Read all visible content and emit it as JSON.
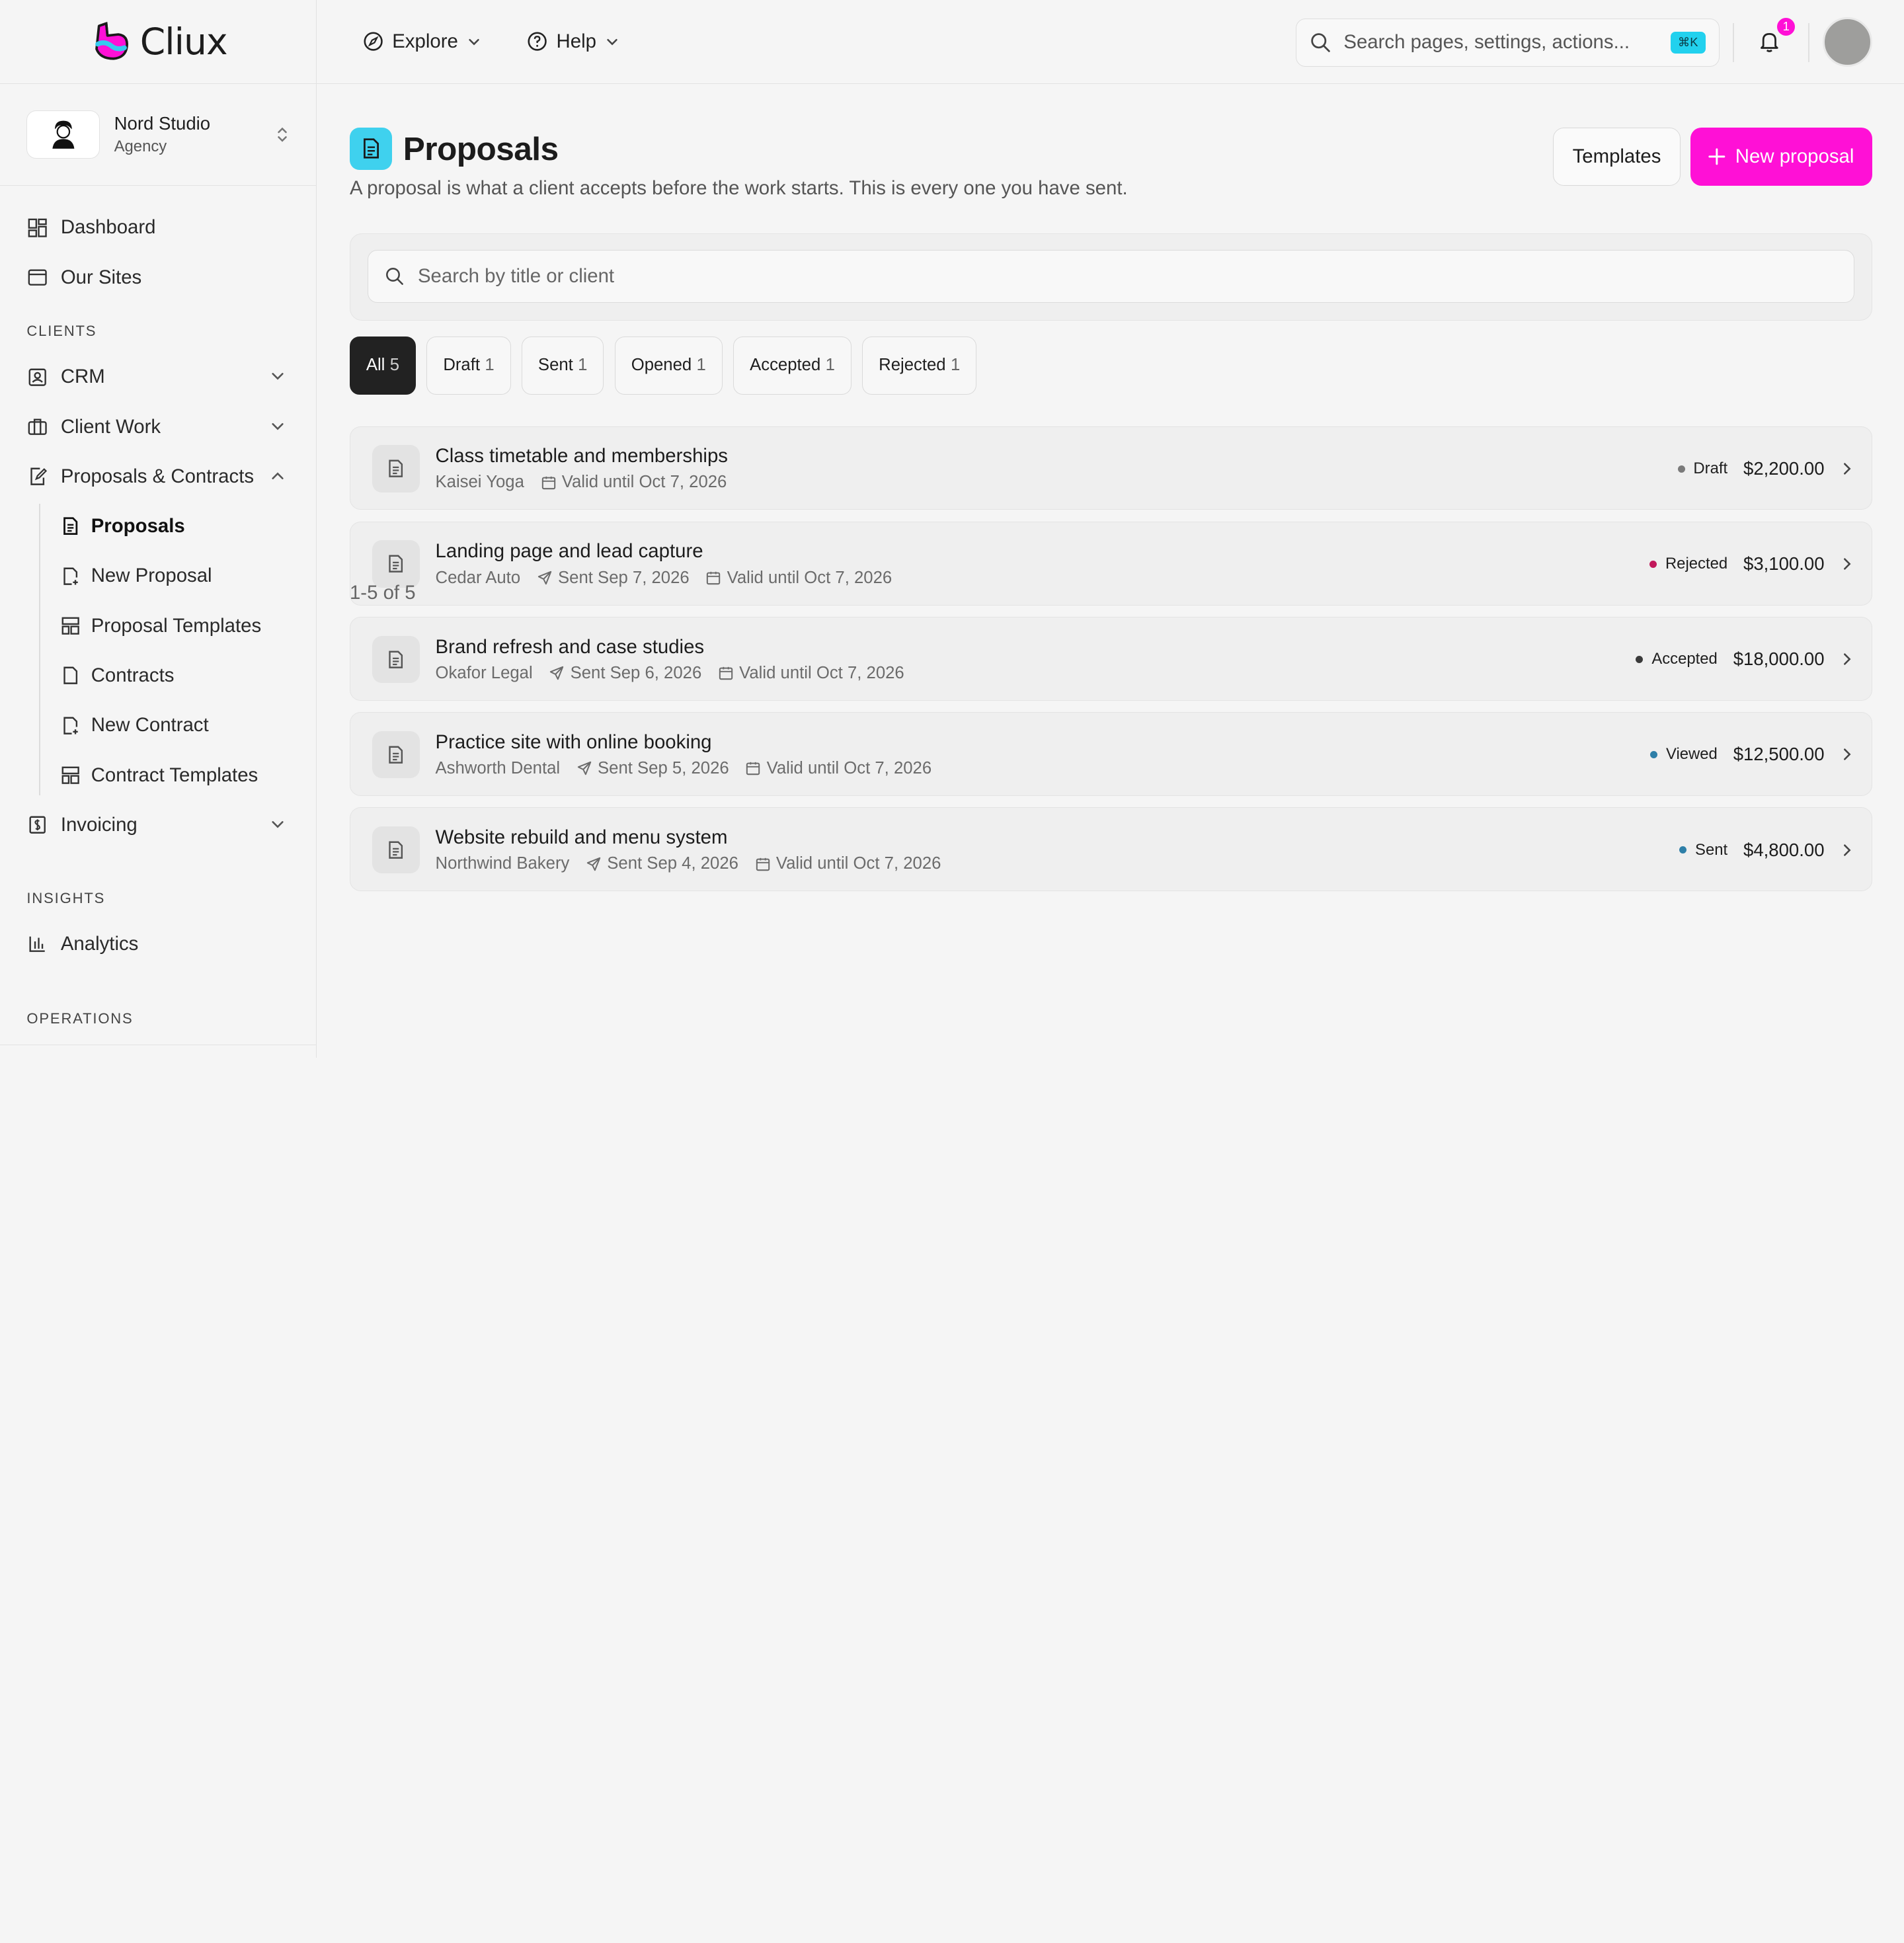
{
  "app": {
    "logo_text": "Cliux"
  },
  "workspace": {
    "name": "Nord Studio",
    "role": "Agency"
  },
  "sidebar": {
    "top_items": [
      {
        "label": "Dashboard",
        "icon": "dashboard-icon"
      },
      {
        "label": "Our Sites",
        "icon": "browser-window-icon"
      }
    ],
    "sections": {
      "clients": "CLIENTS",
      "insights": "INSIGHTS",
      "operations": "OPERATIONS"
    },
    "clients_items": [
      {
        "label": "CRM",
        "icon": "contact-card-icon"
      },
      {
        "label": "Client Work",
        "icon": "briefcase-icon"
      },
      {
        "label": "Proposals & Contracts",
        "icon": "document-edit-icon"
      }
    ],
    "sub_items": [
      {
        "label": "Proposals",
        "icon": "document-icon"
      },
      {
        "label": "New Proposal",
        "icon": "document-plus-icon"
      },
      {
        "label": "Proposal Templates",
        "icon": "template-icon"
      },
      {
        "label": "Contracts",
        "icon": "contract-icon"
      },
      {
        "label": "New Contract",
        "icon": "document-plus-icon"
      },
      {
        "label": "Contract Templates",
        "icon": "template-icon"
      }
    ],
    "invoicing": {
      "label": "Invoicing",
      "icon": "invoice-icon"
    },
    "analytics": {
      "label": "Analytics",
      "icon": "bar-chart-icon"
    }
  },
  "topbar": {
    "explore": "Explore",
    "help": "Help",
    "search_placeholder": "Search pages, settings, actions...",
    "shortcut": "⌘K",
    "notification_count": "1"
  },
  "page": {
    "title": "Proposals",
    "subtitle": "A proposal is what a client accepts before the work starts. This is every one you have sent.",
    "templates_button": "Templates",
    "new_button": "New proposal",
    "search_placeholder": "Search by title or client"
  },
  "filters": [
    {
      "label": "All",
      "count": "5"
    },
    {
      "label": "Draft",
      "count": "1"
    },
    {
      "label": "Sent",
      "count": "1"
    },
    {
      "label": "Opened",
      "count": "1"
    },
    {
      "label": "Accepted",
      "count": "1"
    },
    {
      "label": "Rejected",
      "count": "1"
    }
  ],
  "proposals": [
    {
      "title": "Class timetable and memberships",
      "client": "Kaisei Yoga",
      "sent": "",
      "valid": "Valid until Oct 7, 2026",
      "status": "Draft",
      "status_color": "#7a7a7a",
      "amount": "$2,200.00"
    },
    {
      "title": "Landing page and lead capture",
      "client": "Cedar Auto",
      "sent": "Sent Sep 7, 2026",
      "valid": "Valid until Oct 7, 2026",
      "status": "Rejected",
      "status_color": "#c2185b",
      "amount": "$3,100.00"
    },
    {
      "title": "Brand refresh and case studies",
      "client": "Okafor Legal",
      "sent": "Sent Sep 6, 2026",
      "valid": "Valid until Oct 7, 2026",
      "status": "Accepted",
      "status_color": "#3a3a3a",
      "amount": "$18,000.00"
    },
    {
      "title": "Practice site with online booking",
      "client": "Ashworth Dental",
      "sent": "Sent Sep 5, 2026",
      "valid": "Valid until Oct 7, 2026",
      "status": "Viewed",
      "status_color": "#2e7fa8",
      "amount": "$12,500.00"
    },
    {
      "title": "Website rebuild and menu system",
      "client": "Northwind Bakery",
      "sent": "Sent Sep 4, 2026",
      "valid": "Valid until Oct 7, 2026",
      "status": "Sent",
      "status_color": "#2e7fa8",
      "amount": "$4,800.00"
    }
  ],
  "pager": "1-5 of 5",
  "colors": {
    "accent": "#ff10d6",
    "cyan": "#3fd1ee"
  }
}
